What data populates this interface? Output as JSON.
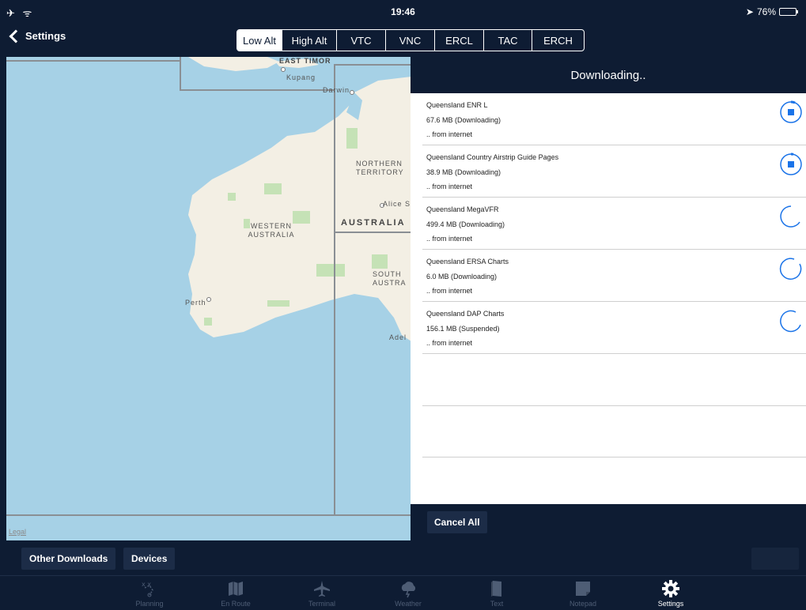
{
  "status": {
    "left": "✈ ᯤ",
    "time": "19:46",
    "battery_text": "76%",
    "location_glyph": "➤"
  },
  "nav": {
    "back_label": "Settings",
    "chart_tabs": [
      "Low Alt",
      "High Alt",
      "VTC",
      "VNC",
      "ERCL",
      "TAC",
      "ERCH"
    ],
    "active_tab": "Low Alt"
  },
  "map": {
    "labels": {
      "east_timor": "EAST TIMOR",
      "kupang": "Kupang",
      "darwin": "Darwin",
      "northern_territory": "NORTHERN TERRITORY",
      "alice": "Alice S",
      "western_australia": "WESTERN AUSTRALIA",
      "australia": "AUSTRALIA",
      "south_australia": "SOUTH AUSTRA",
      "perth": "Perth",
      "adelaide": "Adel"
    },
    "legal": "Legal"
  },
  "panel": {
    "title": "Downloading..",
    "items": [
      {
        "name": "Queensland ENR L",
        "size": "67.6 MB (Downloading)",
        "source": ".. from internet",
        "state": "stop"
      },
      {
        "name": "Queensland Country Airstrip Guide Pages",
        "size": "38.9 MB (Downloading)",
        "source": ".. from internet",
        "state": "stop"
      },
      {
        "name": "Queensland MegaVFR",
        "size": "499.4 MB (Downloading)",
        "source": ".. from internet",
        "state": "waiting"
      },
      {
        "name": "Queensland ERSA Charts",
        "size": "6.0 MB (Downloading)",
        "source": ".. from internet",
        "state": "waiting"
      },
      {
        "name": "Queensland DAP Charts",
        "size": "156.1 MB (Suspended)",
        "source": ".. from internet",
        "state": "waiting"
      }
    ],
    "cancel_all": "Cancel All"
  },
  "toolbar": {
    "other_downloads": "Other Downloads",
    "devices": "Devices"
  },
  "tabs": [
    {
      "label": "Planning",
      "icon": "planning-icon"
    },
    {
      "label": "En Route",
      "icon": "map-icon"
    },
    {
      "label": "Terminal",
      "icon": "airplane-icon"
    },
    {
      "label": "Weather",
      "icon": "weather-icon"
    },
    {
      "label": "Text",
      "icon": "book-icon"
    },
    {
      "label": "Notepad",
      "icon": "notepad-icon"
    },
    {
      "label": "Settings",
      "icon": "gear-icon"
    }
  ],
  "active_main_tab": "Settings",
  "colors": {
    "bar": "#0e1c33",
    "accent": "#1a73e8",
    "ocean": "#a6d1e6",
    "land": "#f3efe4",
    "park": "#c5e2b6"
  }
}
